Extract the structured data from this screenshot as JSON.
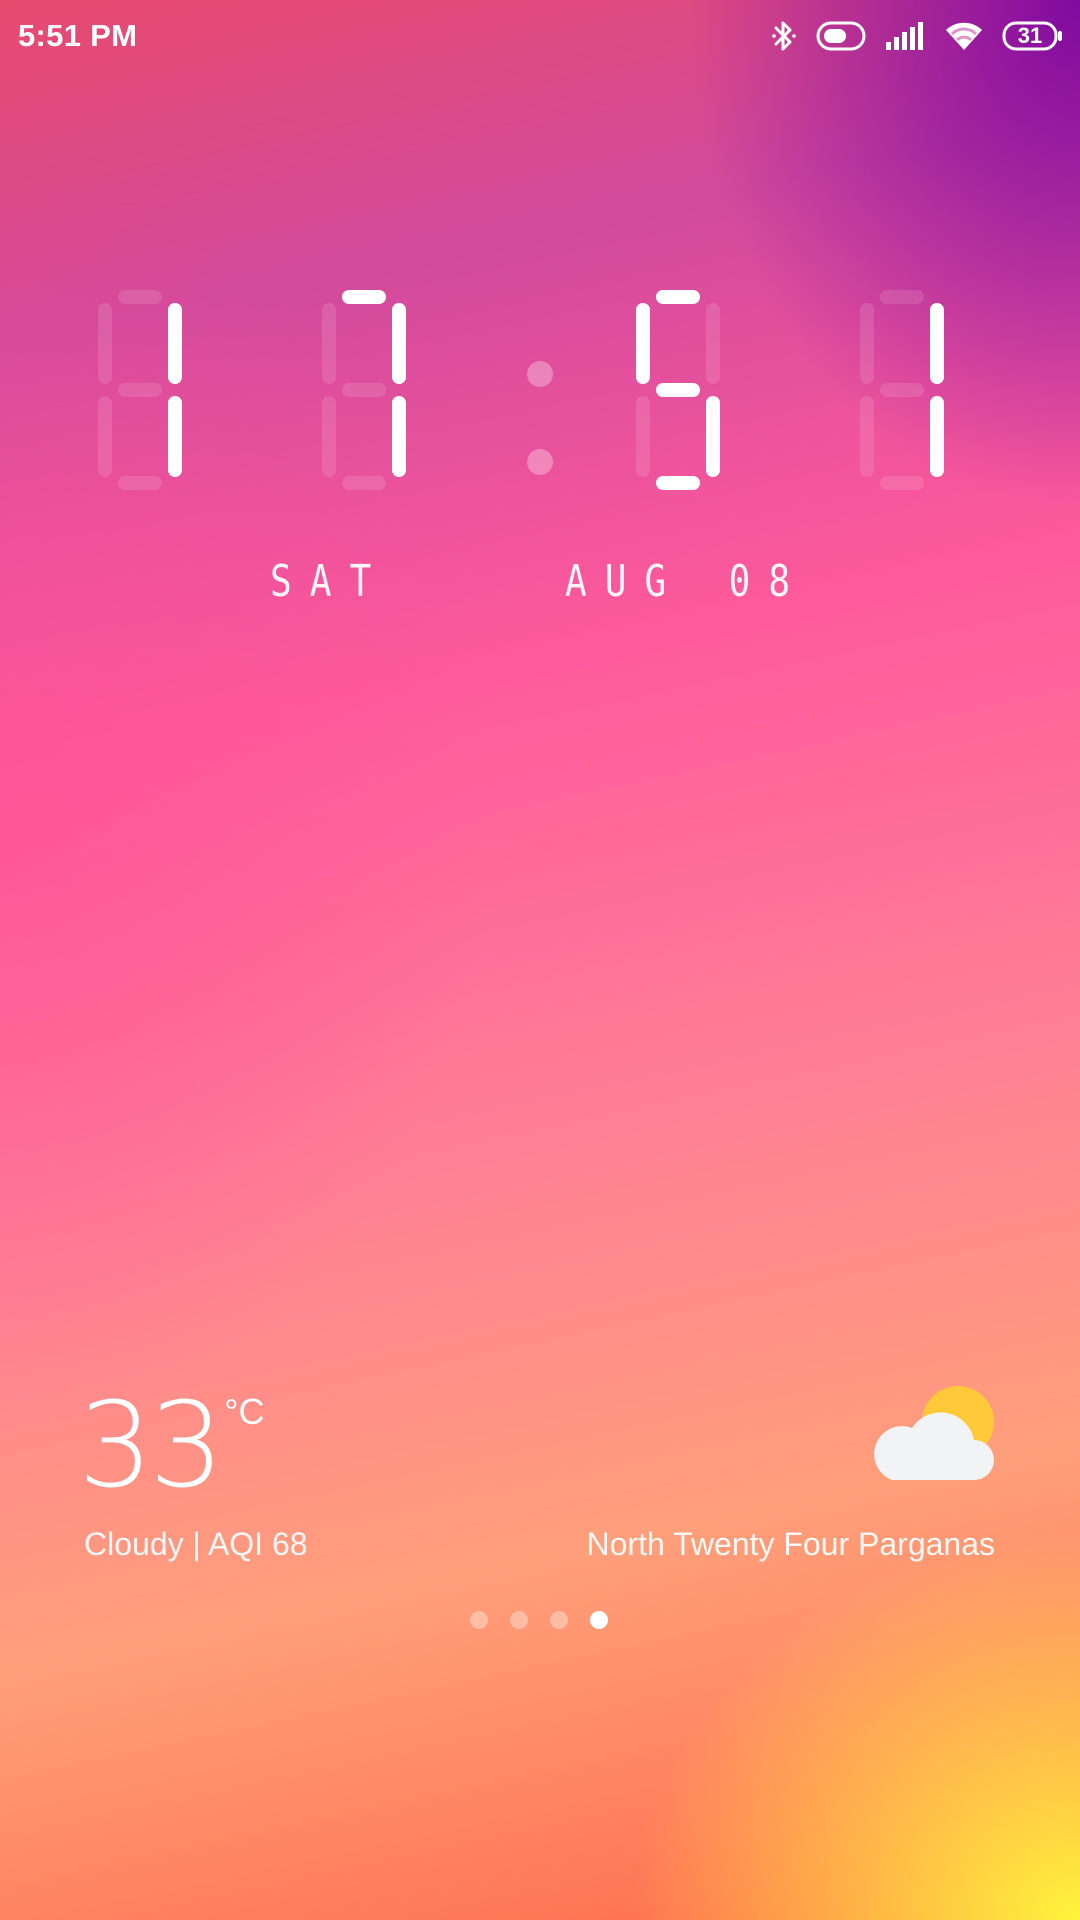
{
  "status_bar": {
    "time": "5:51 PM",
    "battery_level": "31",
    "icons": [
      "bluetooth-icon",
      "toggle-icon",
      "signal-icon",
      "wifi-icon",
      "battery-icon"
    ]
  },
  "clock": {
    "digits": [
      "1",
      "7",
      "5",
      "1"
    ],
    "display_time": "17:51",
    "day": "SAT",
    "month": "AUG",
    "date": "08"
  },
  "weather": {
    "temperature": "33",
    "unit": "°C",
    "condition": "Cloudy | AQI 68",
    "location": "North Twenty Four Parganas",
    "icon": "partly-cloudy-icon"
  },
  "pager": {
    "count": 4,
    "active_index": 3
  },
  "colors": {
    "top_left": "#e84a6e",
    "top_right": "#800aa0",
    "middle": "#ff5a9c",
    "bottom_right": "#fff53c",
    "bottom_left": "#ff6a4a",
    "sun": "#ffc93a",
    "cloud": "#f1f3f5"
  }
}
